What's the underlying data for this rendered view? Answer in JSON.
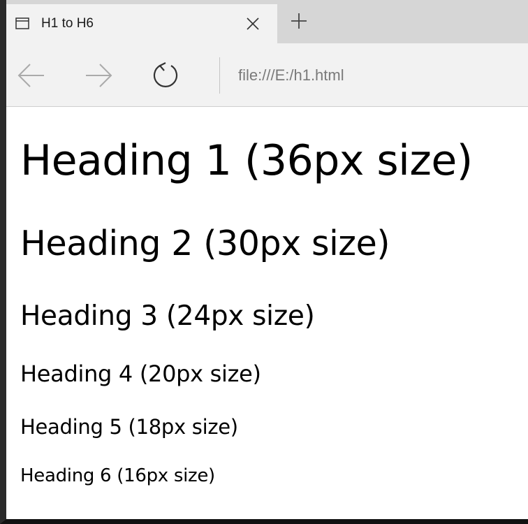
{
  "tab": {
    "title": "H1 to H6",
    "icon": "window-icon",
    "close_icon": "close-icon"
  },
  "toolbar": {
    "new_tab_icon": "plus-icon",
    "back_icon": "arrow-left-icon",
    "forward_icon": "arrow-right-icon",
    "refresh_icon": "refresh-icon"
  },
  "address_bar": {
    "value": "file:///E:/h1.html"
  },
  "page": {
    "headings": [
      "Heading 1 (36px size)",
      "Heading 2 (30px size)",
      "Heading 3 (24px size)",
      "Heading 4 (20px size)",
      "Heading 5 (18px size)",
      "Heading 6 (16px size)"
    ]
  },
  "colors": {
    "tabstrip": "#d6d6d6",
    "active_tab": "#f2f2f2",
    "address_text": "#7a7a7a",
    "page_text": "#000000",
    "icon_stroke": "#333333"
  }
}
